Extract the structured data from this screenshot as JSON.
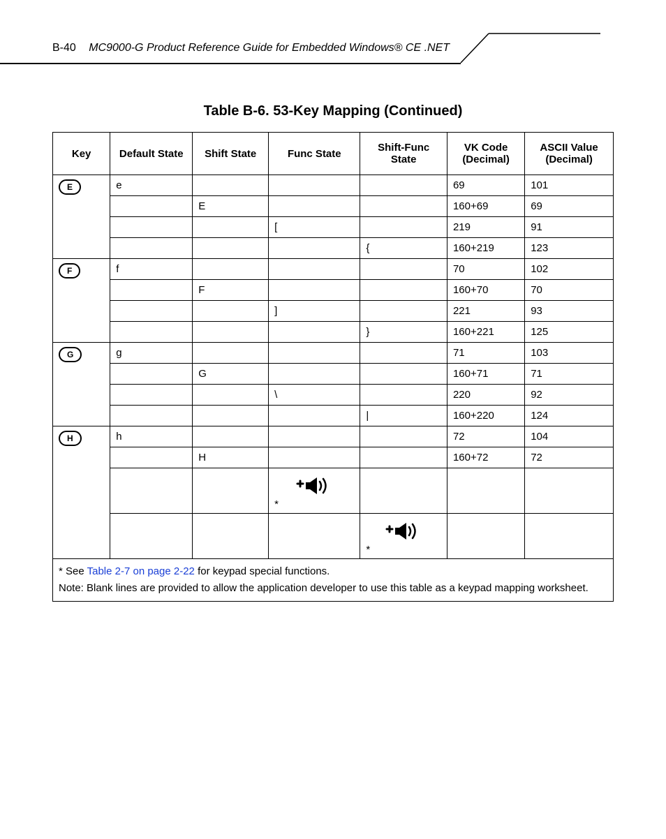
{
  "header": {
    "page_number": "B-40",
    "doc_title": "MC9000-G Product Reference Guide for Embedded Windows® CE .NET"
  },
  "table_title": "Table B-6. 53-Key Mapping (Continued)",
  "columns": {
    "key": "Key",
    "default_state": "Default State",
    "shift_state": "Shift State",
    "func_state": "Func State",
    "shift_func_state": "Shift-Func State",
    "vk_code": "VK Code (Decimal)",
    "ascii": "ASCII Value (Decimal)"
  },
  "chart_data": {
    "type": "table",
    "title": "53-Key Mapping (Continued)",
    "columns": [
      "Key",
      "Default State",
      "Shift State",
      "Func State",
      "Shift-Func State",
      "VK Code (Decimal)",
      "ASCII Value (Decimal)"
    ],
    "groups": [
      {
        "key_label": "E",
        "rows": [
          {
            "default": "e",
            "shift": "",
            "func": "",
            "sfunc": "",
            "vk": "69",
            "ascii": "101"
          },
          {
            "default": "",
            "shift": "E",
            "func": "",
            "sfunc": "",
            "vk": "160+69",
            "ascii": "69"
          },
          {
            "default": "",
            "shift": "",
            "func": "[",
            "sfunc": "",
            "vk": "219",
            "ascii": "91"
          },
          {
            "default": "",
            "shift": "",
            "func": "",
            "sfunc": "{",
            "vk": "160+219",
            "ascii": "123"
          }
        ]
      },
      {
        "key_label": "F",
        "rows": [
          {
            "default": "f",
            "shift": "",
            "func": "",
            "sfunc": "",
            "vk": "70",
            "ascii": "102"
          },
          {
            "default": "",
            "shift": "F",
            "func": "",
            "sfunc": "",
            "vk": "160+70",
            "ascii": "70"
          },
          {
            "default": "",
            "shift": "",
            "func": "]",
            "sfunc": "",
            "vk": "221",
            "ascii": "93"
          },
          {
            "default": "",
            "shift": "",
            "func": "",
            "sfunc": "}",
            "vk": "160+221",
            "ascii": "125"
          }
        ]
      },
      {
        "key_label": "G",
        "rows": [
          {
            "default": "g",
            "shift": "",
            "func": "",
            "sfunc": "",
            "vk": "71",
            "ascii": "103"
          },
          {
            "default": "",
            "shift": "G",
            "func": "",
            "sfunc": "",
            "vk": "160+71",
            "ascii": "71"
          },
          {
            "default": "",
            "shift": "",
            "func": "\\",
            "sfunc": "",
            "vk": "220",
            "ascii": "92"
          },
          {
            "default": "",
            "shift": "",
            "func": "",
            "sfunc": "|",
            "vk": "160+220",
            "ascii": "124"
          }
        ]
      },
      {
        "key_label": "H",
        "rows": [
          {
            "default": "h",
            "shift": "",
            "func": "",
            "sfunc": "",
            "vk": "72",
            "ascii": "104"
          },
          {
            "default": "",
            "shift": "H",
            "func": "",
            "sfunc": "",
            "vk": "160+72",
            "ascii": "72"
          },
          {
            "default": "",
            "shift": "",
            "func": "volume-up-icon",
            "sfunc": "",
            "vk": "",
            "ascii": "",
            "icon": true,
            "star": "*"
          },
          {
            "default": "",
            "shift": "",
            "func": "",
            "sfunc": "volume-up-icon",
            "vk": "",
            "ascii": "",
            "icon": true,
            "star": "*"
          }
        ]
      }
    ]
  },
  "footer": {
    "star": "*",
    "see_prefix": " See ",
    "link_text": "Table 2-7 on page 2-22",
    "see_suffix": " for keypad special functions.",
    "note": "Note: Blank lines are provided to allow the application developer to use this table as a keypad mapping worksheet."
  },
  "icons": {
    "volume_up_asterisk": "*"
  }
}
